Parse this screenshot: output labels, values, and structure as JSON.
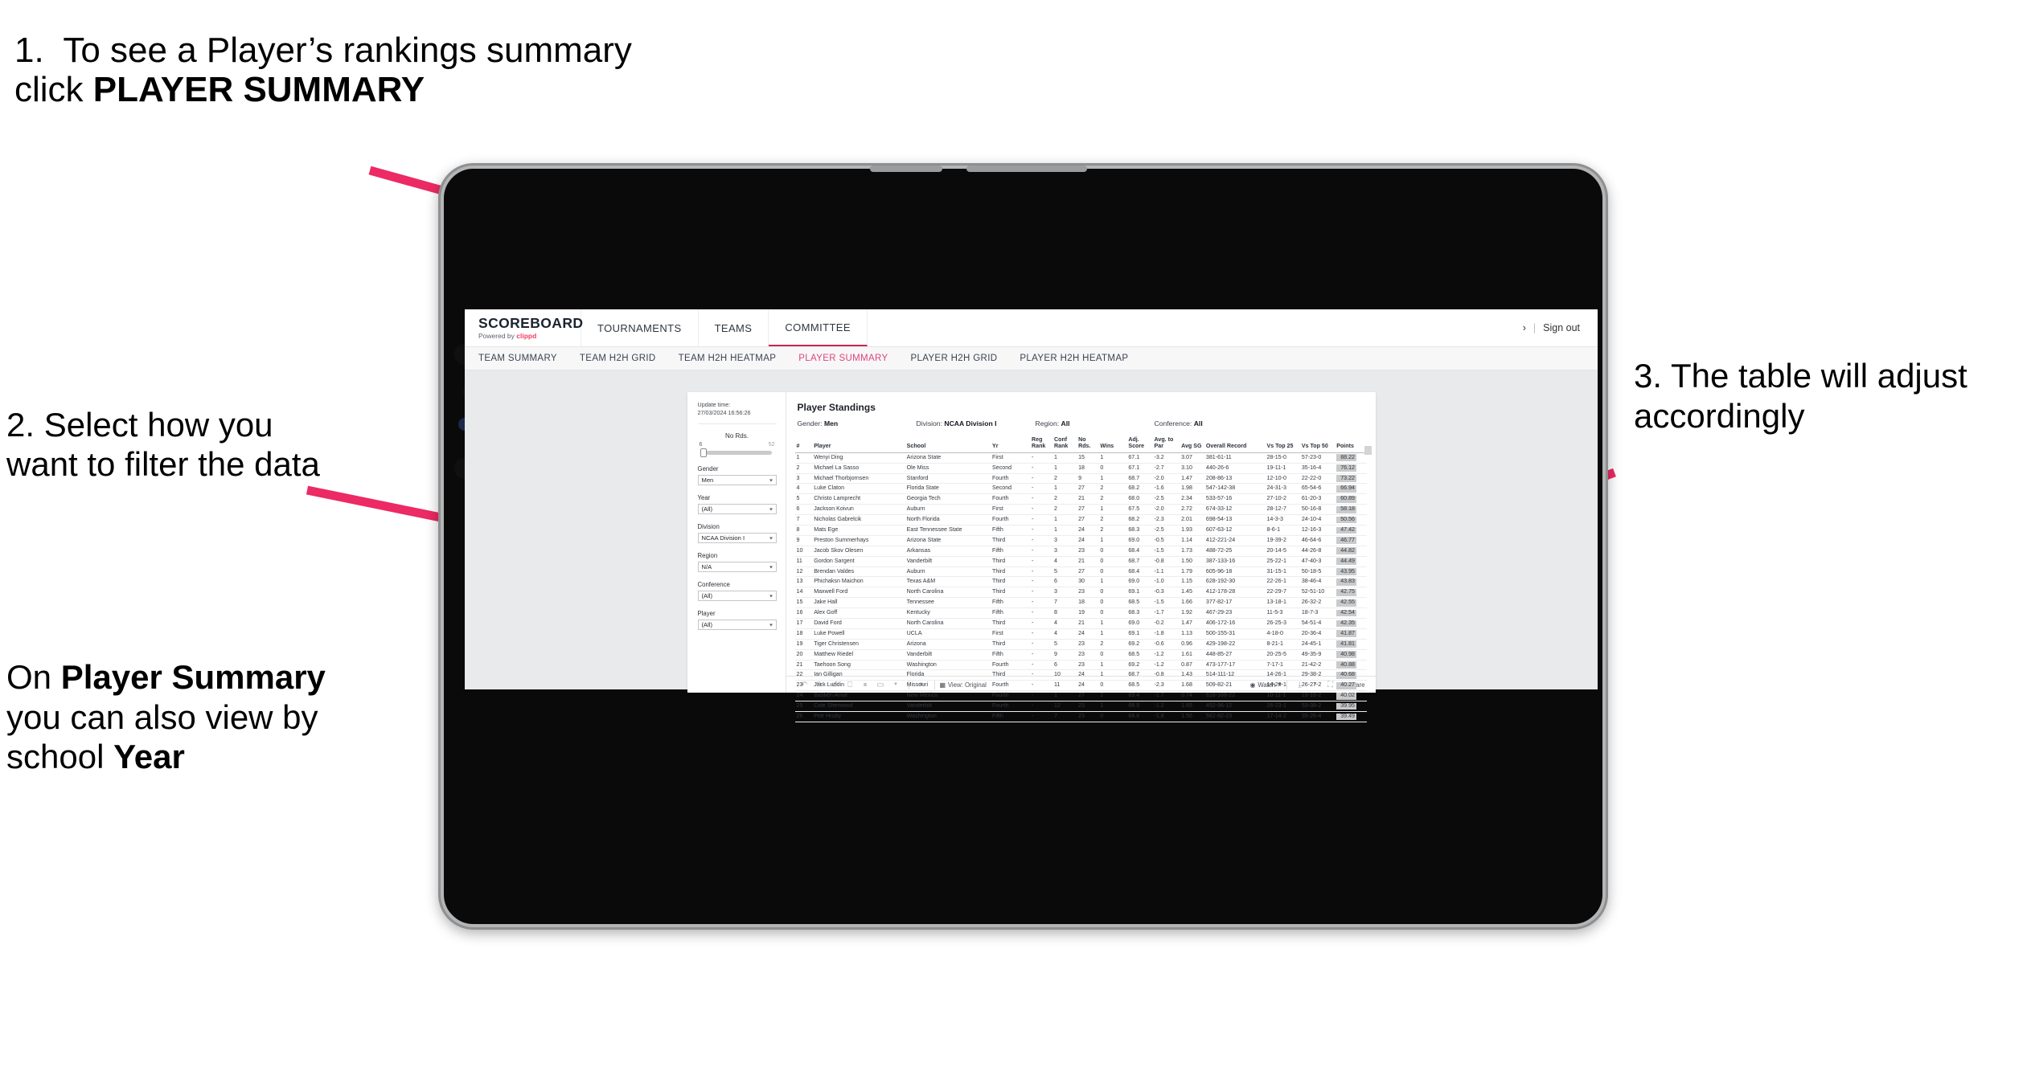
{
  "annotations": {
    "step1": {
      "number": "1.",
      "text_a": "To see a Player’s rankings summary click ",
      "bold": "PLAYER SUMMARY"
    },
    "step2": {
      "text": "2. Select how you want to filter the data"
    },
    "step2b": {
      "pre": "On ",
      "bold1": "Player Summary",
      "mid": " you can also view by school ",
      "bold2": "Year"
    },
    "step3": {
      "text": "3. The table will adjust accordingly"
    },
    "arrow_color": "#ec2a63"
  },
  "header": {
    "logo_main": "SCOREBOARD",
    "logo_sub_pre": "Powered by ",
    "logo_sub_brand": "clippd",
    "nav": [
      {
        "label": "TOURNAMENTS",
        "active": false
      },
      {
        "label": "TEAMS",
        "active": false
      },
      {
        "label": "COMMITTEE",
        "active": true
      }
    ],
    "user_glyph": "›",
    "separator": "|",
    "sign_out": "Sign out"
  },
  "subnav": {
    "items": [
      {
        "label": "TEAM SUMMARY",
        "active": false
      },
      {
        "label": "TEAM H2H GRID",
        "active": false
      },
      {
        "label": "TEAM H2H HEATMAP",
        "active": false
      },
      {
        "label": "PLAYER SUMMARY",
        "active": true
      },
      {
        "label": "PLAYER H2H GRID",
        "active": false
      },
      {
        "label": "PLAYER H2H HEATMAP",
        "active": false
      }
    ],
    "active_color": "#e0447b"
  },
  "filters": {
    "update_label": "Update time:",
    "update_value": "27/03/2024 16:56:26",
    "slider": {
      "label": "No Rds.",
      "min": "6",
      "max": "52"
    },
    "selects": [
      {
        "label": "Gender",
        "value": "Men"
      },
      {
        "label": "Year",
        "value": "(All)"
      },
      {
        "label": "Division",
        "value": "NCAA Division I"
      },
      {
        "label": "Region",
        "value": "N/A"
      },
      {
        "label": "Conference",
        "value": "(All)"
      },
      {
        "label": "Player",
        "value": "(All)"
      }
    ]
  },
  "panel": {
    "title": "Player Standings",
    "crumbs": [
      {
        "label": "Gender:",
        "value": "Men"
      },
      {
        "label": "Division:",
        "value": "NCAA Division I"
      },
      {
        "label": "Region:",
        "value": "All"
      },
      {
        "label": "Conference:",
        "value": "All"
      }
    ]
  },
  "table": {
    "columns": [
      "#",
      "Player",
      "School",
      "Yr",
      "Reg Rank",
      "Conf Rank",
      "No Rds.",
      "Wins",
      "Adj. Score",
      "Avg. to Par",
      "Avg SG",
      "Overall Record",
      "Vs Top 25",
      "Vs Top 50",
      "Points"
    ],
    "rows": [
      [
        "1",
        "Wenyi Ding",
        "Arizona State",
        "First",
        "-",
        "1",
        "15",
        "1",
        "67.1",
        "-3.2",
        "3.07",
        "381-61-11",
        "28-15-0",
        "57-23-0",
        "88.22"
      ],
      [
        "2",
        "Michael La Sasso",
        "Ole Miss",
        "Second",
        "-",
        "1",
        "18",
        "0",
        "67.1",
        "-2.7",
        "3.10",
        "440-26-6",
        "19-11-1",
        "35-16-4",
        "76.12"
      ],
      [
        "3",
        "Michael Thorbjornsen",
        "Stanford",
        "Fourth",
        "-",
        "2",
        "9",
        "1",
        "68.7",
        "-2.0",
        "1.47",
        "208-86-13",
        "12-10-0",
        "22-22-0",
        "73.22"
      ],
      [
        "4",
        "Luke Claton",
        "Florida State",
        "Second",
        "-",
        "1",
        "27",
        "2",
        "68.2",
        "-1.6",
        "1.98",
        "547-142-38",
        "24-31-3",
        "65-54-6",
        "66.94"
      ],
      [
        "5",
        "Christo Lamprecht",
        "Georgia Tech",
        "Fourth",
        "-",
        "2",
        "21",
        "2",
        "68.0",
        "-2.5",
        "2.34",
        "533-57-16",
        "27-10-2",
        "61-20-3",
        "60.89"
      ],
      [
        "6",
        "Jackson Koivun",
        "Auburn",
        "First",
        "-",
        "2",
        "27",
        "1",
        "67.5",
        "-2.0",
        "2.72",
        "674-33-12",
        "28-12-7",
        "50-16-8",
        "58.18"
      ],
      [
        "7",
        "Nicholas Gabrelcik",
        "North Florida",
        "Fourth",
        "-",
        "1",
        "27",
        "2",
        "68.2",
        "-2.3",
        "2.01",
        "698-54-13",
        "14-3-3",
        "24-10-4",
        "50.56"
      ],
      [
        "8",
        "Mats Ege",
        "East Tennessee State",
        "Fifth",
        "-",
        "1",
        "24",
        "2",
        "68.3",
        "-2.5",
        "1.93",
        "607-63-12",
        "8-6-1",
        "12-16-3",
        "47.42"
      ],
      [
        "9",
        "Preston Summerhays",
        "Arizona State",
        "Third",
        "-",
        "3",
        "24",
        "1",
        "69.0",
        "-0.5",
        "1.14",
        "412-221-24",
        "19-39-2",
        "46-64-6",
        "46.77"
      ],
      [
        "10",
        "Jacob Skov Olesen",
        "Arkansas",
        "Fifth",
        "-",
        "3",
        "23",
        "0",
        "68.4",
        "-1.5",
        "1.73",
        "488-72-25",
        "20-14-5",
        "44-26-8",
        "44.82"
      ],
      [
        "11",
        "Gordon Sargent",
        "Vanderbilt",
        "Third",
        "-",
        "4",
        "21",
        "0",
        "68.7",
        "-0.8",
        "1.50",
        "387-133-16",
        "25-22-1",
        "47-40-3",
        "44.49"
      ],
      [
        "12",
        "Brendan Valdes",
        "Auburn",
        "Third",
        "-",
        "5",
        "27",
        "0",
        "68.4",
        "-1.1",
        "1.79",
        "605-96-18",
        "31-15-1",
        "50-18-5",
        "43.95"
      ],
      [
        "13",
        "Phichaksn Maichon",
        "Texas A&M",
        "Third",
        "-",
        "6",
        "30",
        "1",
        "69.0",
        "-1.0",
        "1.15",
        "628-192-30",
        "22-26-1",
        "38-46-4",
        "43.83"
      ],
      [
        "14",
        "Maxwell Ford",
        "North Carolina",
        "Third",
        "-",
        "3",
        "23",
        "0",
        "69.1",
        "-0.3",
        "1.45",
        "412-178-28",
        "22-29-7",
        "52-51-10",
        "42.75"
      ],
      [
        "15",
        "Jake Hall",
        "Tennessee",
        "Fifth",
        "-",
        "7",
        "18",
        "0",
        "68.5",
        "-1.5",
        "1.66",
        "377-82-17",
        "13-18-1",
        "26-32-2",
        "42.55"
      ],
      [
        "16",
        "Alex Goff",
        "Kentucky",
        "Fifth",
        "-",
        "8",
        "19",
        "0",
        "68.3",
        "-1.7",
        "1.92",
        "467-29-23",
        "11-5-3",
        "18-7-3",
        "42.54"
      ],
      [
        "17",
        "David Ford",
        "North Carolina",
        "Third",
        "-",
        "4",
        "21",
        "1",
        "69.0",
        "-0.2",
        "1.47",
        "406-172-16",
        "26-25-3",
        "54-51-4",
        "42.35"
      ],
      [
        "18",
        "Luke Powell",
        "UCLA",
        "First",
        "-",
        "4",
        "24",
        "1",
        "69.1",
        "-1.8",
        "1.13",
        "500-155-31",
        "4-18-0",
        "20-36-4",
        "41.87"
      ],
      [
        "19",
        "Tiger Christensen",
        "Arizona",
        "Third",
        "-",
        "5",
        "23",
        "2",
        "69.2",
        "-0.6",
        "0.96",
        "429-198-22",
        "8-21-1",
        "24-45-1",
        "41.81"
      ],
      [
        "20",
        "Matthew Riedel",
        "Vanderbilt",
        "Fifth",
        "-",
        "9",
        "23",
        "0",
        "68.5",
        "-1.2",
        "1.61",
        "448-85-27",
        "20-25-5",
        "49-35-9",
        "40.98"
      ],
      [
        "21",
        "Taehoon Song",
        "Washington",
        "Fourth",
        "-",
        "6",
        "23",
        "1",
        "69.2",
        "-1.2",
        "0.87",
        "473-177-17",
        "7-17-1",
        "21-42-2",
        "40.88"
      ],
      [
        "22",
        "Ian Gilligan",
        "Florida",
        "Third",
        "-",
        "10",
        "24",
        "1",
        "68.7",
        "-0.8",
        "1.43",
        "514-111-12",
        "14-26-1",
        "29-38-2",
        "40.68"
      ],
      [
        "23",
        "Jack Lundin",
        "Missouri",
        "Fourth",
        "-",
        "11",
        "24",
        "0",
        "68.5",
        "-2.3",
        "1.68",
        "509-82-21",
        "14-20-1",
        "26-27-2",
        "40.27"
      ],
      [
        "24",
        "Bastien Amat",
        "New Mexico",
        "Fourth",
        "-",
        "1",
        "27",
        "2",
        "69.4",
        "-1.7",
        "0.74",
        "616-168-22",
        "10-11-1",
        "19-16-2",
        "40.02"
      ],
      [
        "25",
        "Cole Sherwood",
        "Vanderbilt",
        "Fourth",
        "-",
        "12",
        "23",
        "1",
        "68.5",
        "-1.2",
        "1.65",
        "452-96-12",
        "26-23-1",
        "53-38-2",
        "39.95"
      ],
      [
        "26",
        "Petr Hruby",
        "Washington",
        "Fifth",
        "-",
        "7",
        "23",
        "0",
        "68.6",
        "-1.8",
        "1.56",
        "562-82-23",
        "17-14-2",
        "35-26-4",
        "39.49"
      ]
    ]
  },
  "toolbar": {
    "icons": [
      "undo-icon",
      "redo-icon",
      "revert-icon",
      "refresh-icon",
      "pause-icon",
      "rectangle-select-icon",
      "dropdown-caret-icon",
      "zoom-icon"
    ],
    "view_label": "View: Original",
    "watch_label": "Watch",
    "share_label": "Share"
  }
}
